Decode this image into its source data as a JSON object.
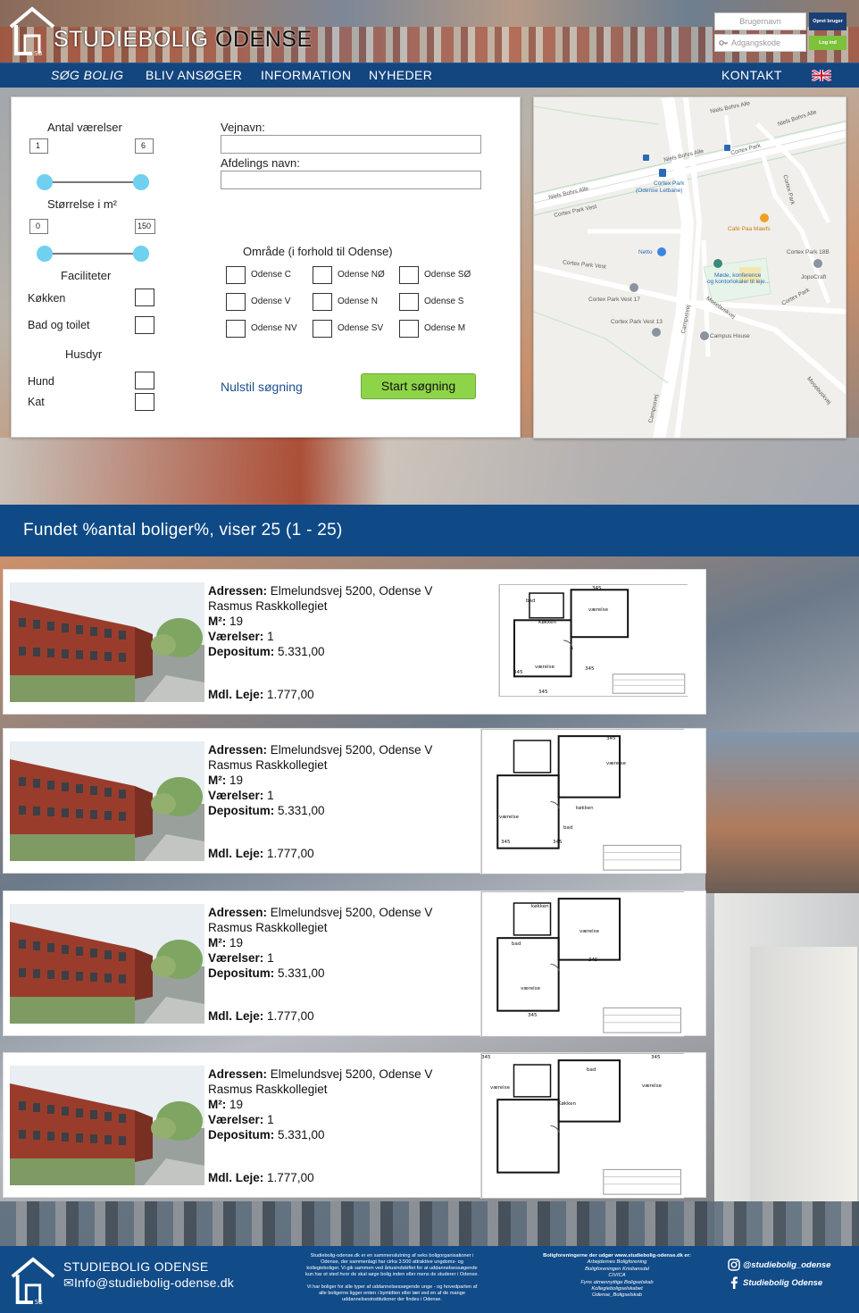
{
  "header": {
    "title_part1": "STUDIEBOLIG",
    "title_part2": "ODENSE",
    "username_placeholder": "Brugernavn",
    "password_placeholder": "Adgangskode",
    "create_user_label": "Opret bruger",
    "login_label": "Log ind",
    "logo_initials": "SB"
  },
  "nav": {
    "items": [
      "SØG BOLIG",
      "BLIV ANSØGER",
      "INFORMATION",
      "NYHEDER"
    ],
    "contact": "KONTAKT",
    "active_index": 0
  },
  "search": {
    "rooms_label": "Antal værelser",
    "rooms_min": "1",
    "rooms_max": "6",
    "size_label": "Størrelse i m²",
    "size_min": "0",
    "size_max": "150",
    "facilities_label": "Faciliteter",
    "facilities": [
      "Køkken",
      "Bad og toilet"
    ],
    "pets_label": "Husdyr",
    "pets": [
      "Hund",
      "Kat"
    ],
    "street_label": "Vejnavn:",
    "street_value": "",
    "department_label": "Afdelings navn:",
    "department_value": "",
    "area_label": "Område (i forhold til Odense)",
    "areas": [
      "Odense C",
      "Odense NØ",
      "Odense SØ",
      "Odense V",
      "Odense N",
      "Odense S",
      "Odense NV",
      "Odense SV",
      "Odense M"
    ],
    "reset_label": "Nulstil søgning",
    "start_label": "Start søgning"
  },
  "map": {
    "labels": [
      "Niels Bohrs Alle",
      "Niels Bohrs Alle",
      "Niels Bohrs Alle",
      "Niels Bohrs Alle",
      "Cortex Park",
      "Cortex Park",
      "(Odense Letbane)",
      "Cortex Park Vest",
      "Cortex Park",
      "Café Paa Mawfs",
      "Netto",
      "Cortex Park 18B",
      "JopoCraft",
      "Cortex Park Vest",
      "Møde, konference",
      "og kontorlokaler til leje...",
      "Cortex Park Vest 17",
      "Cortex Park Vest 13",
      "Campus House",
      "Cortex Park",
      "Campusvej",
      "Campusvej",
      "Mosebuskvej",
      "Mosebuskvej"
    ]
  },
  "results": {
    "summary": "Fundet %antal boliger%, viser 25 (1 - 25)"
  },
  "listings": [
    {
      "address_label": "Adressen:",
      "address": "Elmelundsvej 5200, Odense V",
      "name": "Rasmus Raskkollegiet",
      "m2_label": "M²:",
      "m2": "19",
      "rooms_label": "Værelser:",
      "rooms": "1",
      "deposit_label": "Depositum:",
      "deposit": "5.331,00",
      "rent_label": "Mdl. Leje:",
      "rent": "1.777,00",
      "plan_labels": [
        "345",
        "bad",
        "Køkken",
        "værelse",
        "værelse",
        "345",
        "345",
        "345"
      ]
    },
    {
      "address_label": "Adressen:",
      "address": "Elmelundsvej 5200, Odense V",
      "name": "Rasmus Raskkollegiet",
      "m2_label": "M²:",
      "m2": "19",
      "rooms_label": "Værelser:",
      "rooms": "1",
      "deposit_label": "Depositum:",
      "deposit": "5.331,00",
      "rent_label": "Mdl. Leje:",
      "rent": "1.777,00",
      "plan_labels": [
        "345",
        "værelse",
        "køkken",
        "værelse",
        "bad",
        "345",
        "345"
      ]
    },
    {
      "address_label": "Adressen:",
      "address": "Elmelundsvej 5200, Odense V",
      "name": "Rasmus Raskkollegiet",
      "m2_label": "M²:",
      "m2": "19",
      "rooms_label": "Værelser:",
      "rooms": "1",
      "deposit_label": "Depositum:",
      "deposit": "5.331,00",
      "rent_label": "Mdl. Leje:",
      "rent": "1.777,00",
      "plan_labels": [
        "køkken",
        "værelse",
        "bad",
        "værelse",
        "345",
        "345"
      ]
    },
    {
      "address_label": "Adressen:",
      "address": "Elmelundsvej 5200, Odense V",
      "name": "Rasmus Raskkollegiet",
      "m2_label": "M²:",
      "m2": "19",
      "rooms_label": "Værelser:",
      "rooms": "1",
      "deposit_label": "Depositum:",
      "deposit": "5.331,00",
      "rent_label": "Mdl. Leje:",
      "rent": "1.777,00",
      "plan_labels": [
        "345",
        "345",
        "bad",
        "værelse",
        "værelse",
        "Køkken"
      ]
    }
  ],
  "footer": {
    "name": "STUDIEBOLIG ODENSE",
    "email": "Info@studiebolig-odense.dk",
    "about_lines": [
      "Studiebolig-odense.dk er en sammenslutning af seks boligorganisationer i",
      "Odense, der sammenlagt har cirka 3.500 attraktive ungdoms- og",
      "kollegieboliger. Vi gik sammen ved årtusindskiftet for at uddannelsessøgende",
      "kun har et sted hvor de skal søge bolig inden eller mens de studerer i Odense.",
      "",
      "Vi har boliger for alle typer af uddannelsessøgende unge - og hovedparten af",
      "alle boligerne ligger enten i bymidten eller tæt ved en af de mange",
      "uddannelsesinstitutioner der findes i Odense."
    ],
    "orgs_heading": "Boligforeningerne der udgør www.studiebolig-odense.dk er:",
    "orgs": [
      "Arbejdernes Boligforening",
      "Boligforeningen Kristiansdal",
      "CIVICA",
      "Fyns almennyttige Boligselskab",
      "Kollegieboligselskabet",
      "Odense_Boligselskab"
    ],
    "instagram": "@studiebolig_odense",
    "facebook": "Studiebolig Odense"
  },
  "colors": {
    "brand_blue": "#13457f",
    "accent_green": "#8ed448",
    "slider_blue": "#6fd0f0"
  }
}
